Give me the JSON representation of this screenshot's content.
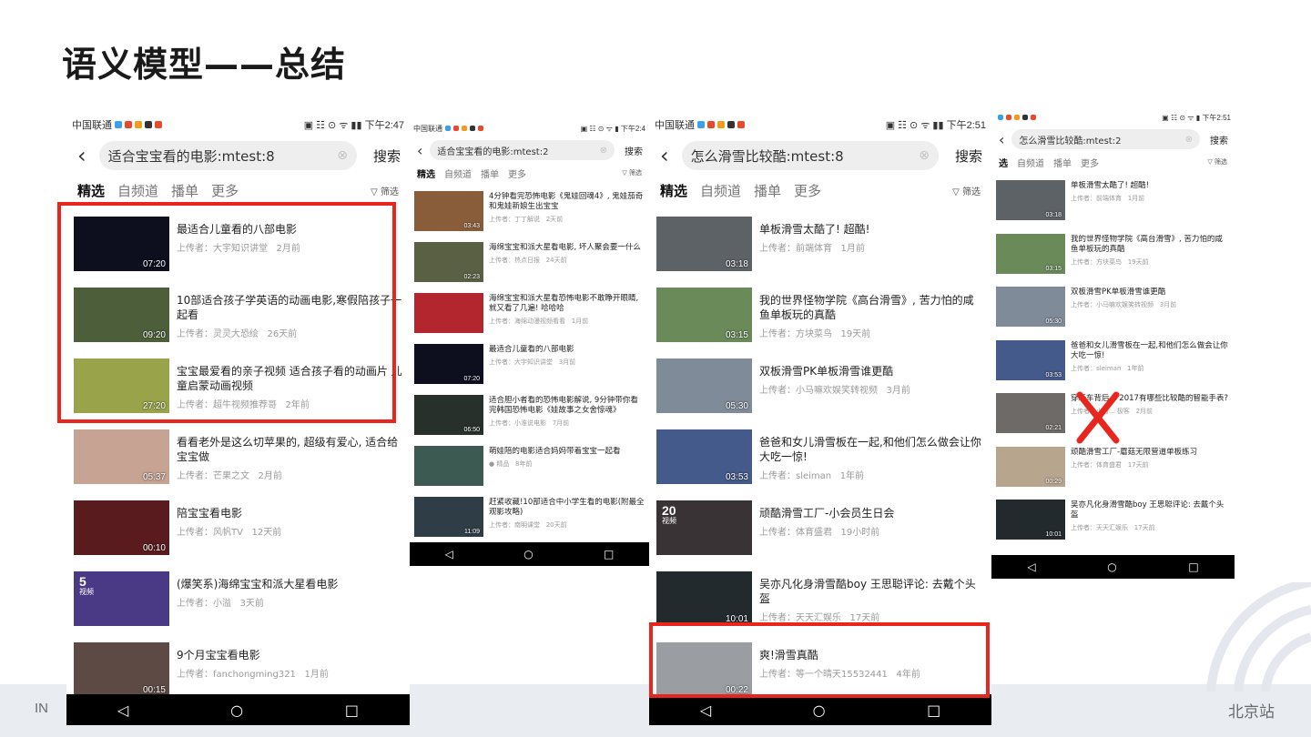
{
  "slide": {
    "title": "语义模型——总结",
    "footer_left": "IN",
    "footer_right": "北京站"
  },
  "phones": [
    {
      "status_carrier": "中国联通",
      "status_right": "▣ ☷ ⊙ ᯤ ▮▮ 下午2:47",
      "query": "适合宝宝看的电影:mtest:8",
      "search_label": "搜索",
      "tabs": [
        "精选",
        "自频道",
        "播单",
        "更多"
      ],
      "filter_label": "▽ 筛选",
      "nav": [
        "◁",
        "○",
        "□"
      ],
      "videos": [
        {
          "title": "最适合儿童看的八部电影",
          "uploader": "上传者：大宇知识讲堂",
          "age": "2月前",
          "duration": "07:20",
          "badge": "",
          "badge_sub": "",
          "thumb": "#0d0f1f"
        },
        {
          "title": "10部适合孩子学英语的动画电影,寒假陪孩子一起看",
          "uploader": "上传者：灵灵大恐绘",
          "age": "26天前",
          "duration": "09:20",
          "badge": "",
          "badge_sub": "",
          "thumb": "#4d5f3a"
        },
        {
          "title": "宝宝最爱看的亲子视频 适合孩子看的动画片 儿童启蒙动画视频",
          "uploader": "上传者：超牛视频推荐哥",
          "age": "2年前",
          "duration": "27:20",
          "badge": "",
          "badge_sub": "",
          "thumb": "#98a34a"
        },
        {
          "title": "看看老外是这么切苹果的, 超级有爱心, 适合给宝宝做",
          "uploader": "上传者：芒果之文",
          "age": "2月前",
          "duration": "05:37",
          "badge": "",
          "badge_sub": "",
          "thumb": "#c7a393"
        },
        {
          "title": "陪宝宝看电影",
          "uploader": "上传者：风帆TV",
          "age": "12天前",
          "duration": "00:10",
          "badge": "",
          "badge_sub": "",
          "thumb": "#5a1b1e"
        },
        {
          "title": "(爆笑系)海绵宝宝和派大星看电影",
          "uploader": "上传者：小溢",
          "age": "3天前",
          "duration": "",
          "badge": "5",
          "badge_sub": "视频",
          "thumb": "#4a3a86"
        },
        {
          "title": "9个月宝宝看电影",
          "uploader": "上传者：fanchongming321",
          "age": "1月前",
          "duration": "00:15",
          "badge": "",
          "badge_sub": "",
          "thumb": "#5e4a44"
        }
      ]
    },
    {
      "status_carrier": "中国联通",
      "status_right": "▣ ☷ ⊙ ᯤ ▮ 下午2:4",
      "query": "适合宝宝看的电影:mtest:2",
      "search_label": "搜索",
      "tabs": [
        "精选",
        "自频道",
        "播单",
        "更多"
      ],
      "filter_label": "▽ 筛选",
      "nav": [
        "◁",
        "○",
        "□"
      ],
      "videos": [
        {
          "title": "4分钟看完恐怖电影《鬼娃回魂4》, 鬼娃茄奇和鬼娃新娘生出宝宝",
          "uploader": "上传者：丁丁解说",
          "age": "2天前",
          "duration": "03:43",
          "badge": "",
          "badge_sub": "",
          "thumb": "#8a5d3a"
        },
        {
          "title": "海绵宝宝和派大星看电影, 坏人聚会要一什么",
          "uploader": "上传者：热点日报",
          "age": "24天前",
          "duration": "02:23",
          "badge": "",
          "badge_sub": "",
          "thumb": "#596044"
        },
        {
          "title": "海绵宝宝和派大星看恐怖电影不敢睁开眼睛, 就又看了几遍! 哈哈哈",
          "uploader": "上传者：海绵动漫视频看看",
          "age": "1月前",
          "duration": "",
          "badge": "",
          "badge_sub": "",
          "thumb": "#b3262e"
        },
        {
          "title": "最适合儿童看的八部电影",
          "uploader": "上传者：大宇知识讲堂",
          "age": "3月前",
          "duration": "07:20",
          "badge": "",
          "badge_sub": "",
          "thumb": "#0d0f1f"
        },
        {
          "title": "适合胆小者看的恐怖电影解说, 9分钟带你看完韩国恐怖电影《娃故事之女舍惊魂》",
          "uploader": "上传者：小淮说电影",
          "age": "7月前",
          "duration": "06:50",
          "badge": "",
          "badge_sub": "",
          "thumb": "#27302a"
        },
        {
          "title": "萌娃陪的电影适合妈妈带着宝宝一起看",
          "uploader": "● 精品",
          "age": "8年前",
          "duration": "",
          "badge": "",
          "badge_sub": "",
          "thumb": "#3d5a52"
        },
        {
          "title": "赶紧收藏!10部适合中小学生看的电影(附最全观影攻略)",
          "uploader": "上传者：南明课堂",
          "age": "20天前",
          "duration": "11:09",
          "badge": "",
          "badge_sub": "",
          "thumb": "#2f3d46"
        }
      ]
    },
    {
      "status_carrier": "中国联通",
      "status_right": "▣ ☷ ⊙ ᯤ ▮▮ 下午2:51",
      "query": "怎么滑雪比较酷:mtest:8",
      "search_label": "搜索",
      "tabs": [
        "精选",
        "自频道",
        "播单",
        "更多"
      ],
      "filter_label": "▽ 筛选",
      "nav": [
        "◁",
        "○",
        "□"
      ],
      "videos": [
        {
          "title": "单板滑雪太酷了! 超酷!",
          "uploader": "上传者：前端体育",
          "age": "1月前",
          "duration": "03:18",
          "badge": "",
          "badge_sub": "",
          "thumb": "#5d6266"
        },
        {
          "title": "我的世界怪物学院《高台滑雪》, 苦力怕的咸鱼单板玩的真酷",
          "uploader": "上传者：方块菜鸟",
          "age": "19天前",
          "duration": "03:15",
          "badge": "",
          "badge_sub": "",
          "thumb": "#6a8a5a"
        },
        {
          "title": "双板滑雪PK单板滑雪谁更酷",
          "uploader": "上传者：小马嘛欢娱笑转视频",
          "age": "3月前",
          "duration": "05:30",
          "badge": "",
          "badge_sub": "",
          "thumb": "#7f8b98"
        },
        {
          "title": "爸爸和女儿滑雪板在一起,和他们怎么做会让你大吃一惊!",
          "uploader": "上传者：sleiman",
          "age": "1年前",
          "duration": "03:53",
          "badge": "",
          "badge_sub": "",
          "thumb": "#445a8a"
        },
        {
          "title": "顽酷滑雪工厂-小会员生日会",
          "uploader": "上传者：体育盛君",
          "age": "19小时前",
          "duration": "",
          "badge": "20",
          "badge_sub": "视频",
          "thumb": "#3a3336"
        },
        {
          "title": "吴亦凡化身滑雪酷boy 王思聪评论: 去戴个头盔",
          "uploader": "上传者：天天汇娱乐",
          "age": "17天前",
          "duration": "10:01",
          "badge": "",
          "badge_sub": "",
          "thumb": "#232a2e"
        },
        {
          "title": "爽!滑雪真酷",
          "uploader": "上传者：等一个晴天15532441",
          "age": "4年前",
          "duration": "00:22",
          "badge": "",
          "badge_sub": "",
          "thumb": "#9a9ea2"
        }
      ]
    },
    {
      "status_carrier": "",
      "status_right": "▣ ☷ ⊙ ᯤ ▮ 下午2:51",
      "query": "怎么滑雪比较酷:mtest:2",
      "search_label": "搜索",
      "tabs": [
        "选",
        "自频道",
        "播单",
        "更多"
      ],
      "filter_label": "▽ 筛选",
      "nav": [
        "◁",
        "○",
        "□"
      ],
      "videos": [
        {
          "title": "单板滑雪太酷了! 超酷!",
          "uploader": "上传者：前端体育",
          "age": "1月前",
          "duration": "03:18",
          "badge": "",
          "badge_sub": "",
          "thumb": "#5d6266"
        },
        {
          "title": "我的世界怪物学院《高台滑雪》, 苦力怕的咸鱼单板玩的真酷",
          "uploader": "上传者：方块菜鸟",
          "age": "19天前",
          "duration": "03:15",
          "badge": "",
          "badge_sub": "",
          "thumb": "#6a8a5a"
        },
        {
          "title": "双板滑雪PK单板滑雪谁更酷",
          "uploader": "上传者：小马嘛欢娱笑转视频",
          "age": "3月前",
          "duration": "05:30",
          "badge": "",
          "badge_sub": "",
          "thumb": "#7f8b98"
        },
        {
          "title": "爸爸和女儿滑雪板在一起,和他们怎么做会让你大吃一惊!",
          "uploader": "上传者：sleiman",
          "age": "1年前",
          "duration": "03:53",
          "badge": "",
          "badge_sub": "",
          "thumb": "#445a8a"
        },
        {
          "title": "穿玩车背后... 2017有哪些比较酷的智能手表?",
          "uploader": "上传者：小智... 极客",
          "age": "2月前",
          "duration": "02:21",
          "badge": "",
          "badge_sub": "",
          "thumb": "#6e6a68"
        },
        {
          "title": "顽酷滑雪工厂-蘑菇无限营道单板练习",
          "uploader": "上传者：体育盛君",
          "age": "17天前",
          "duration": "00:29",
          "badge": "",
          "badge_sub": "",
          "thumb": "#b7a58e"
        },
        {
          "title": "吴亦凡化身滑雪酷boy 王思聪评论: 去戴个头盔",
          "uploader": "上传者：天天汇娱乐",
          "age": "17天前",
          "duration": "10:01",
          "badge": "",
          "badge_sub": "",
          "thumb": "#232a2e"
        }
      ]
    }
  ],
  "colors": {
    "highlight_box": "#e8261d",
    "reject_mark": "#e8261d"
  }
}
